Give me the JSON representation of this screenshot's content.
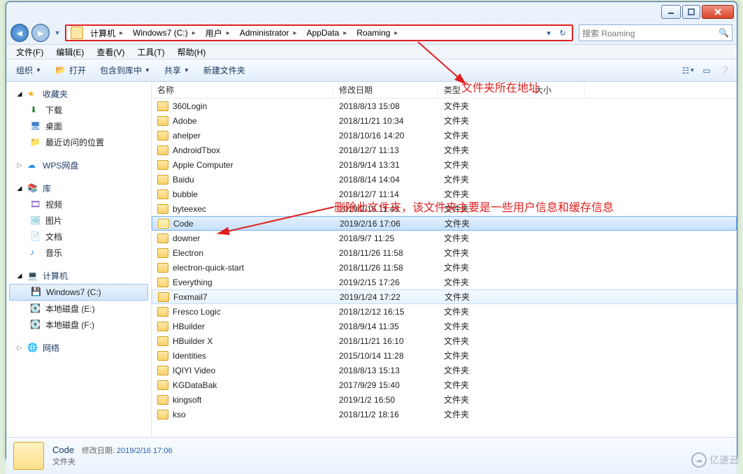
{
  "window": {
    "min_tip": "最小化",
    "max_tip": "最大化",
    "close_tip": "关闭"
  },
  "breadcrumb": [
    "计算机",
    "Windows7 (C:)",
    "用户",
    "Administrator",
    "AppData",
    "Roaming"
  ],
  "search": {
    "placeholder": "搜索 Roaming"
  },
  "menubar": [
    "文件(F)",
    "编辑(E)",
    "查看(V)",
    "工具(T)",
    "帮助(H)"
  ],
  "cmdbar": {
    "organize": "组织",
    "open": "打开",
    "library": "包含到库中",
    "share": "共享",
    "newfolder": "新建文件夹"
  },
  "sidebar": {
    "favorites": {
      "label": "收藏夹",
      "items": [
        "下载",
        "桌面",
        "最近访问的位置"
      ]
    },
    "wps": {
      "label": "WPS网盘"
    },
    "libraries": {
      "label": "库",
      "items": [
        "视频",
        "图片",
        "文档",
        "音乐"
      ]
    },
    "computer": {
      "label": "计算机",
      "items": [
        "Windows7 (C:)",
        "本地磁盘 (E:)",
        "本地磁盘 (F:)"
      ],
      "selected_index": 0
    },
    "network": {
      "label": "网络"
    }
  },
  "columns": {
    "name": "名称",
    "date": "修改日期",
    "type": "类型",
    "size": "大小"
  },
  "files": [
    {
      "name": "360Login",
      "date": "2018/8/13 15:08",
      "type": "文件夹"
    },
    {
      "name": "Adobe",
      "date": "2018/11/21 10:34",
      "type": "文件夹"
    },
    {
      "name": "ahelper",
      "date": "2018/10/16 14:20",
      "type": "文件夹"
    },
    {
      "name": "AndroidTbox",
      "date": "2018/12/7 11:13",
      "type": "文件夹"
    },
    {
      "name": "Apple Computer",
      "date": "2018/9/14 13:31",
      "type": "文件夹"
    },
    {
      "name": "Baidu",
      "date": "2018/8/14 14:04",
      "type": "文件夹"
    },
    {
      "name": "bubble",
      "date": "2018/12/7 11:14",
      "type": "文件夹"
    },
    {
      "name": "byteexec",
      "date": "2019/2/15 11:43",
      "type": "文件夹"
    },
    {
      "name": "Code",
      "date": "2019/2/16 17:06",
      "type": "文件夹",
      "selected": true
    },
    {
      "name": "downer",
      "date": "2018/9/7 11:25",
      "type": "文件夹"
    },
    {
      "name": "Electron",
      "date": "2018/11/26 11:58",
      "type": "文件夹"
    },
    {
      "name": "electron-quick-start",
      "date": "2018/11/26 11:58",
      "type": "文件夹"
    },
    {
      "name": "Everything",
      "date": "2019/2/15 17:26",
      "type": "文件夹"
    },
    {
      "name": "Foxmail7",
      "date": "2019/1/24 17:22",
      "type": "文件夹",
      "hovered": true
    },
    {
      "name": "Fresco Logic",
      "date": "2018/12/12 16:15",
      "type": "文件夹"
    },
    {
      "name": "HBuilder",
      "date": "2018/9/14 11:35",
      "type": "文件夹"
    },
    {
      "name": "HBuilder X",
      "date": "2018/11/21 16:10",
      "type": "文件夹"
    },
    {
      "name": "Identities",
      "date": "2015/10/14 11:28",
      "type": "文件夹"
    },
    {
      "name": "IQIYI Video",
      "date": "2018/8/13 15:13",
      "type": "文件夹"
    },
    {
      "name": "KGDataBak",
      "date": "2017/9/29 15:40",
      "type": "文件夹"
    },
    {
      "name": "kingsoft",
      "date": "2019/1/2 16:50",
      "type": "文件夹"
    },
    {
      "name": "kso",
      "date": "2018/11/2 18:16",
      "type": "文件夹"
    }
  ],
  "details": {
    "name": "Code",
    "meta_label": "修改日期:",
    "meta_value": "2019/2/16 17:06",
    "type": "文件夹"
  },
  "annotations": {
    "addr": "文件夹所在地址",
    "delete": "删除此文件夹，该文件夹主要是一些用户信息和缓存信息"
  },
  "watermark": "亿速云"
}
